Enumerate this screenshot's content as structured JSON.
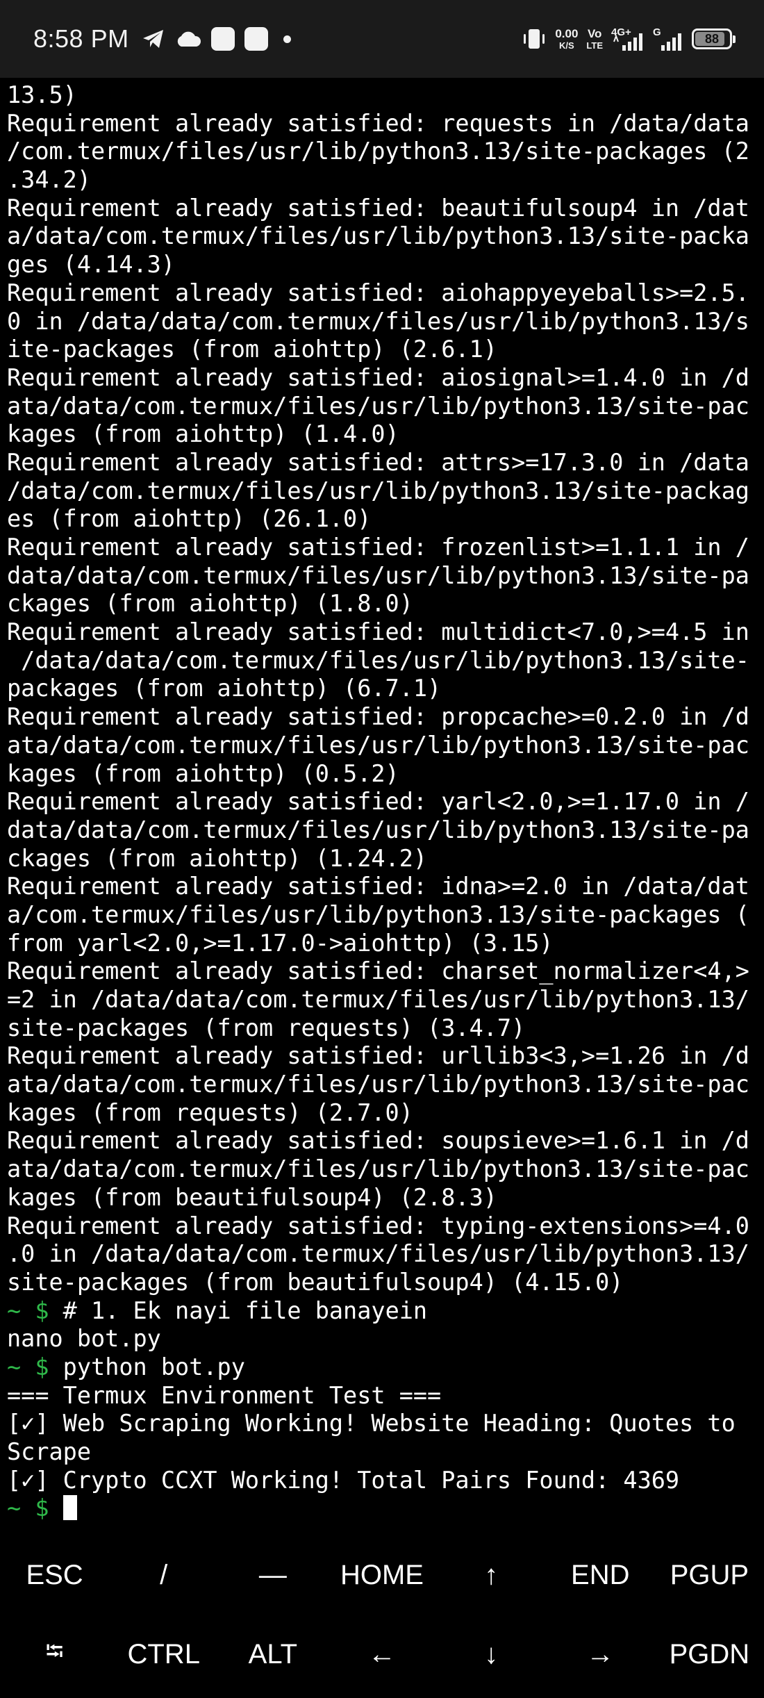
{
  "status_bar": {
    "time": "8:58 PM",
    "left_icons": [
      "telegram-icon",
      "cloud-icon",
      "app-notification-icon",
      "app-notification-icon",
      "more-dot-icon"
    ],
    "data_speed_value": "0.00",
    "data_speed_unit": "K/S",
    "volte_top": "Vo",
    "volte_bottom": "LTE",
    "network_4g": "4G+",
    "network_g": "G",
    "battery_level": "88",
    "battery_fraction": 0.88
  },
  "terminal": {
    "prompt_symbol": "~ $",
    "prompt_color": "#2fb94a",
    "lines": [
      {
        "text": "13.5)"
      },
      {
        "text": "Requirement already satisfied: requests in /data/data"
      },
      {
        "text": "/com.termux/files/usr/lib/python3.13/site-packages (2"
      },
      {
        "text": ".34.2)"
      },
      {
        "text": "Requirement already satisfied: beautifulsoup4 in /dat"
      },
      {
        "text": "a/data/com.termux/files/usr/lib/python3.13/site-packa"
      },
      {
        "text": "ges (4.14.3)"
      },
      {
        "text": "Requirement already satisfied: aiohappyeyeballs>=2.5."
      },
      {
        "text": "0 in /data/data/com.termux/files/usr/lib/python3.13/s"
      },
      {
        "text": "ite-packages (from aiohttp) (2.6.1)"
      },
      {
        "text": "Requirement already satisfied: aiosignal>=1.4.0 in /d"
      },
      {
        "text": "ata/data/com.termux/files/usr/lib/python3.13/site-pac"
      },
      {
        "text": "kages (from aiohttp) (1.4.0)"
      },
      {
        "text": "Requirement already satisfied: attrs>=17.3.0 in /data"
      },
      {
        "text": "/data/com.termux/files/usr/lib/python3.13/site-packag"
      },
      {
        "text": "es (from aiohttp) (26.1.0)"
      },
      {
        "text": "Requirement already satisfied: frozenlist>=1.1.1 in /"
      },
      {
        "text": "data/data/com.termux/files/usr/lib/python3.13/site-pa"
      },
      {
        "text": "ckages (from aiohttp) (1.8.0)"
      },
      {
        "text": "Requirement already satisfied: multidict<7.0,>=4.5 in"
      },
      {
        "text": " /data/data/com.termux/files/usr/lib/python3.13/site-"
      },
      {
        "text": "packages (from aiohttp) (6.7.1)"
      },
      {
        "text": "Requirement already satisfied: propcache>=0.2.0 in /d"
      },
      {
        "text": "ata/data/com.termux/files/usr/lib/python3.13/site-pac"
      },
      {
        "text": "kages (from aiohttp) (0.5.2)"
      },
      {
        "text": "Requirement already satisfied: yarl<2.0,>=1.17.0 in /"
      },
      {
        "text": "data/data/com.termux/files/usr/lib/python3.13/site-pa"
      },
      {
        "text": "ckages (from aiohttp) (1.24.2)"
      },
      {
        "text": "Requirement already satisfied: idna>=2.0 in /data/dat"
      },
      {
        "text": "a/com.termux/files/usr/lib/python3.13/site-packages ("
      },
      {
        "text": "from yarl<2.0,>=1.17.0->aiohttp) (3.15)"
      },
      {
        "text": "Requirement already satisfied: charset_normalizer<4,>"
      },
      {
        "text": "=2 in /data/data/com.termux/files/usr/lib/python3.13/"
      },
      {
        "text": "site-packages (from requests) (3.4.7)"
      },
      {
        "text": "Requirement already satisfied: urllib3<3,>=1.26 in /d"
      },
      {
        "text": "ata/data/com.termux/files/usr/lib/python3.13/site-pac"
      },
      {
        "text": "kages (from requests) (2.7.0)"
      },
      {
        "text": "Requirement already satisfied: soupsieve>=1.6.1 in /d"
      },
      {
        "text": "ata/data/com.termux/files/usr/lib/python3.13/site-pac"
      },
      {
        "text": "kages (from beautifulsoup4) (2.8.3)"
      },
      {
        "text": "Requirement already satisfied: typing-extensions>=4.0"
      },
      {
        "text": ".0 in /data/data/com.termux/files/usr/lib/python3.13/"
      },
      {
        "text": "site-packages (from beautifulsoup4) (4.15.0)"
      },
      {
        "prompt": true,
        "text": " # 1. Ek nayi file banayein"
      },
      {
        "text": "nano bot.py"
      },
      {
        "prompt": true,
        "text": " python bot.py"
      },
      {
        "text": "=== Termux Environment Test ==="
      },
      {
        "text": "[✓] Web Scraping Working! Website Heading: Quotes to"
      },
      {
        "text": "Scrape"
      },
      {
        "text": "[✓] Crypto CCXT Working! Total Pairs Found: 4369"
      },
      {
        "prompt": true,
        "text": " ",
        "cursor": true
      }
    ]
  },
  "extra_keys": {
    "row1": [
      {
        "name": "key-esc",
        "label": "ESC"
      },
      {
        "name": "key-slash",
        "label": "/"
      },
      {
        "name": "key-dash",
        "label": "—"
      },
      {
        "name": "key-home",
        "label": "HOME"
      },
      {
        "name": "key-up-arrow",
        "label": "↑"
      },
      {
        "name": "key-end",
        "label": "END"
      },
      {
        "name": "key-pgup",
        "label": "PGUP"
      }
    ],
    "row2": [
      {
        "name": "key-tab",
        "label": "⭾"
      },
      {
        "name": "key-ctrl",
        "label": "CTRL"
      },
      {
        "name": "key-alt",
        "label": "ALT"
      },
      {
        "name": "key-left-arrow",
        "label": "←"
      },
      {
        "name": "key-down-arrow",
        "label": "↓"
      },
      {
        "name": "key-right-arrow",
        "label": "→"
      },
      {
        "name": "key-pgdn",
        "label": "PGDN"
      }
    ]
  }
}
